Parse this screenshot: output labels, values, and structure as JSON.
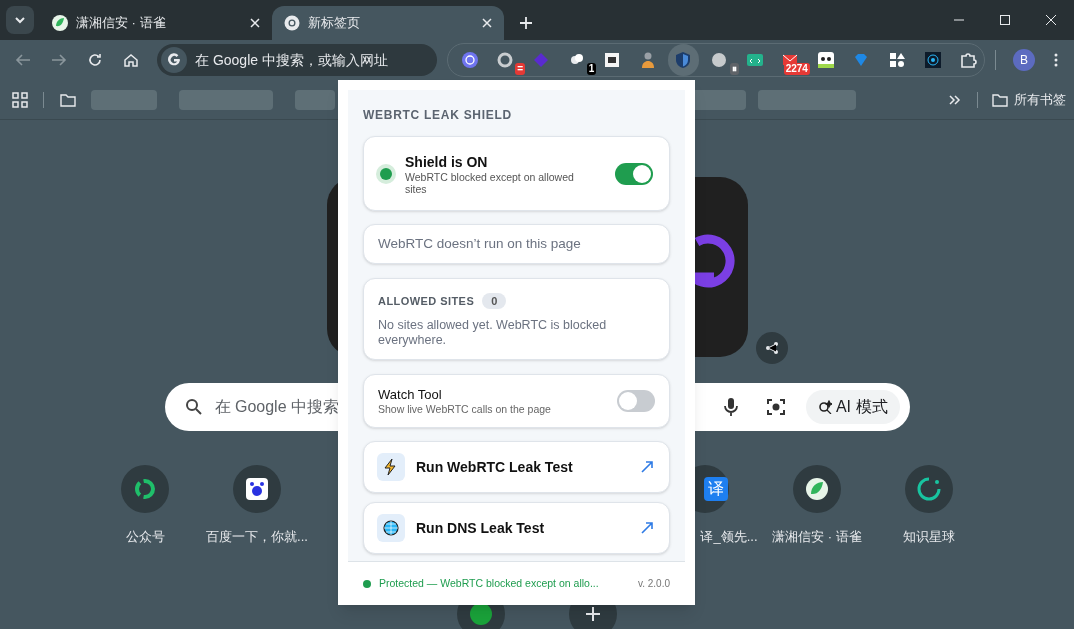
{
  "tabs": [
    {
      "title": "潇湘信安 · 语雀",
      "selected": false,
      "kind": "yuque"
    },
    {
      "title": "新标签页",
      "selected": true,
      "kind": "chrome"
    }
  ],
  "omnibox": {
    "placeholder": "在 Google 中搜索，或输入网址"
  },
  "extensions": [
    {
      "kind": "orb",
      "selected": false
    },
    {
      "kind": "ring",
      "badge": "=",
      "selected": false
    },
    {
      "kind": "diamond",
      "selected": false
    },
    {
      "kind": "cloud",
      "badge": "1",
      "selected": false
    },
    {
      "kind": "face",
      "selected": false
    },
    {
      "kind": "person",
      "selected": false
    },
    {
      "kind": "shield",
      "selected": true
    },
    {
      "kind": "gray",
      "badge": "⏸",
      "selected": false
    },
    {
      "kind": "code",
      "selected": false
    },
    {
      "kind": "mail",
      "badge": "2274",
      "selected": false
    },
    {
      "kind": "panda",
      "selected": false
    },
    {
      "kind": "gem",
      "selected": false
    },
    {
      "kind": "shapes",
      "selected": false
    },
    {
      "kind": "target",
      "selected": false
    },
    {
      "kind": "puzzle",
      "selected": false
    }
  ],
  "profile": {
    "initial": "B"
  },
  "bookmarks": {
    "all_label": "所有书签"
  },
  "popup": {
    "title": "WEBRTC LEAK SHIELD",
    "shield": {
      "title": "Shield is ON",
      "subtitle": "WebRTC blocked except on allowed sites",
      "on": true
    },
    "page_status": "WebRTC doesn’t run on this page",
    "allowed_sites": {
      "label": "ALLOWED SITES",
      "count": "0",
      "empty_text": "No sites allowed yet. WebRTC is blocked everywhere."
    },
    "watch_tool": {
      "title": "Watch Tool",
      "subtitle": "Show live WebRTC calls on the page",
      "on": false
    },
    "actions": [
      {
        "kind": "bolt",
        "label": "Run WebRTC Leak Test"
      },
      {
        "kind": "globe",
        "label": "Run DNS Leak Test"
      }
    ],
    "footer": {
      "status": "Protected — WebRTC blocked except on allo...",
      "version": "v. 2.0.0"
    }
  },
  "ntp": {
    "search_placeholder": "在 Google 中搜索",
    "ai_mode": "AI 模式",
    "shortcuts": [
      {
        "kind": "swirl",
        "label": "公众号"
      },
      {
        "kind": "paw",
        "label": "百度一下，你就..."
      },
      {
        "kind": "translate",
        "icon_text": "译",
        "label": "译_领先..."
      },
      {
        "kind": "yuque",
        "label": "潇湘信安 · 语雀"
      },
      {
        "kind": "ring",
        "label": "知识星球"
      }
    ],
    "second_row": [
      {
        "kind": "green"
      },
      {
        "kind": "add"
      }
    ]
  }
}
